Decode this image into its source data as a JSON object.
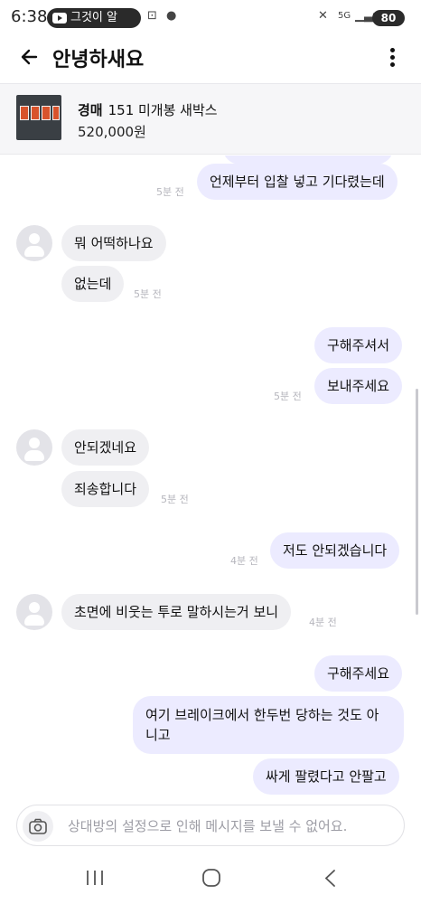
{
  "status_bar": {
    "time": "6:38",
    "notification_pill": "그것이 알",
    "network": "5G",
    "battery": "80"
  },
  "header": {
    "title": "안녕하새요"
  },
  "product": {
    "badge": "경매",
    "name": "151 미개봉 새박스",
    "price": "520,000원"
  },
  "messages": {
    "m1": {
      "text": "언제부터 입찰 넣고 기다렸는데",
      "time": "5분 전"
    },
    "m2": {
      "text": "뭐 어떡하나요"
    },
    "m3": {
      "text": "없는데",
      "time": "5분 전"
    },
    "m4": {
      "text": "구해주셔서"
    },
    "m5": {
      "text": "보내주세요",
      "time": "5분 전"
    },
    "m6": {
      "text": "안되겠네요"
    },
    "m7": {
      "text": "죄송합니다",
      "time": "5분 전"
    },
    "m8": {
      "text": "저도 안되겠습니다",
      "time": "4분 전"
    },
    "m9": {
      "text": "초면에 비웃는 투로 말하시는거 보니",
      "time": "4분 전"
    },
    "m10": {
      "text": "구해주세요"
    },
    "m11": {
      "line1": "여기 브레이크에서 한두번 당하는 것도 아",
      "line2": "니고"
    },
    "m12": {
      "text": "싸게 팔렸다고 안팔고"
    }
  },
  "input": {
    "placeholder": "상대방의 설정으로 인해 메시지를 보낼 수 없어요."
  },
  "colors": {
    "my_bubble": "#ecebff",
    "their_bubble": "#efeff2",
    "timestamp": "#b6b6bd"
  }
}
